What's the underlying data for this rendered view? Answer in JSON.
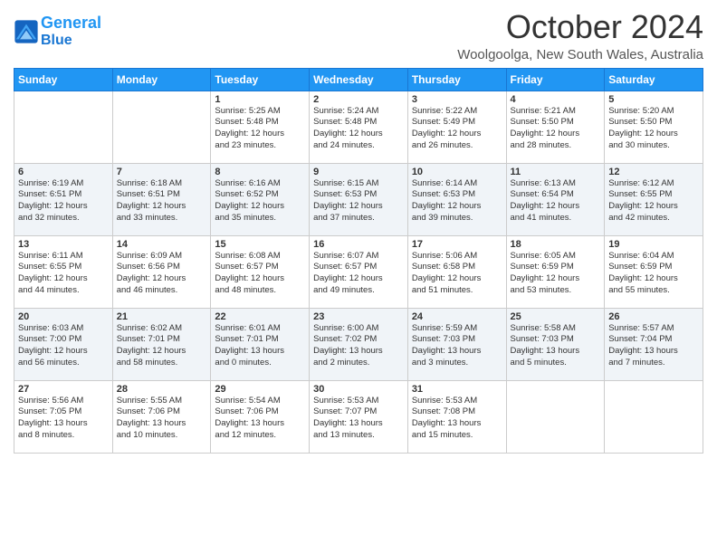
{
  "header": {
    "logo_line1": "General",
    "logo_line2": "Blue",
    "month": "October 2024",
    "location": "Woolgoolga, New South Wales, Australia"
  },
  "days_of_week": [
    "Sunday",
    "Monday",
    "Tuesday",
    "Wednesday",
    "Thursday",
    "Friday",
    "Saturday"
  ],
  "weeks": [
    [
      {
        "day": "",
        "info": ""
      },
      {
        "day": "",
        "info": ""
      },
      {
        "day": "1",
        "info": "Sunrise: 5:25 AM\nSunset: 5:48 PM\nDaylight: 12 hours\nand 23 minutes."
      },
      {
        "day": "2",
        "info": "Sunrise: 5:24 AM\nSunset: 5:48 PM\nDaylight: 12 hours\nand 24 minutes."
      },
      {
        "day": "3",
        "info": "Sunrise: 5:22 AM\nSunset: 5:49 PM\nDaylight: 12 hours\nand 26 minutes."
      },
      {
        "day": "4",
        "info": "Sunrise: 5:21 AM\nSunset: 5:50 PM\nDaylight: 12 hours\nand 28 minutes."
      },
      {
        "day": "5",
        "info": "Sunrise: 5:20 AM\nSunset: 5:50 PM\nDaylight: 12 hours\nand 30 minutes."
      }
    ],
    [
      {
        "day": "6",
        "info": "Sunrise: 6:19 AM\nSunset: 6:51 PM\nDaylight: 12 hours\nand 32 minutes."
      },
      {
        "day": "7",
        "info": "Sunrise: 6:18 AM\nSunset: 6:51 PM\nDaylight: 12 hours\nand 33 minutes."
      },
      {
        "day": "8",
        "info": "Sunrise: 6:16 AM\nSunset: 6:52 PM\nDaylight: 12 hours\nand 35 minutes."
      },
      {
        "day": "9",
        "info": "Sunrise: 6:15 AM\nSunset: 6:53 PM\nDaylight: 12 hours\nand 37 minutes."
      },
      {
        "day": "10",
        "info": "Sunrise: 6:14 AM\nSunset: 6:53 PM\nDaylight: 12 hours\nand 39 minutes."
      },
      {
        "day": "11",
        "info": "Sunrise: 6:13 AM\nSunset: 6:54 PM\nDaylight: 12 hours\nand 41 minutes."
      },
      {
        "day": "12",
        "info": "Sunrise: 6:12 AM\nSunset: 6:55 PM\nDaylight: 12 hours\nand 42 minutes."
      }
    ],
    [
      {
        "day": "13",
        "info": "Sunrise: 6:11 AM\nSunset: 6:55 PM\nDaylight: 12 hours\nand 44 minutes."
      },
      {
        "day": "14",
        "info": "Sunrise: 6:09 AM\nSunset: 6:56 PM\nDaylight: 12 hours\nand 46 minutes."
      },
      {
        "day": "15",
        "info": "Sunrise: 6:08 AM\nSunset: 6:57 PM\nDaylight: 12 hours\nand 48 minutes."
      },
      {
        "day": "16",
        "info": "Sunrise: 6:07 AM\nSunset: 6:57 PM\nDaylight: 12 hours\nand 49 minutes."
      },
      {
        "day": "17",
        "info": "Sunrise: 5:06 AM\nSunset: 6:58 PM\nDaylight: 12 hours\nand 51 minutes."
      },
      {
        "day": "18",
        "info": "Sunrise: 6:05 AM\nSunset: 6:59 PM\nDaylight: 12 hours\nand 53 minutes."
      },
      {
        "day": "19",
        "info": "Sunrise: 6:04 AM\nSunset: 6:59 PM\nDaylight: 12 hours\nand 55 minutes."
      }
    ],
    [
      {
        "day": "20",
        "info": "Sunrise: 6:03 AM\nSunset: 7:00 PM\nDaylight: 12 hours\nand 56 minutes."
      },
      {
        "day": "21",
        "info": "Sunrise: 6:02 AM\nSunset: 7:01 PM\nDaylight: 12 hours\nand 58 minutes."
      },
      {
        "day": "22",
        "info": "Sunrise: 6:01 AM\nSunset: 7:01 PM\nDaylight: 13 hours\nand 0 minutes."
      },
      {
        "day": "23",
        "info": "Sunrise: 6:00 AM\nSunset: 7:02 PM\nDaylight: 13 hours\nand 2 minutes."
      },
      {
        "day": "24",
        "info": "Sunrise: 5:59 AM\nSunset: 7:03 PM\nDaylight: 13 hours\nand 3 minutes."
      },
      {
        "day": "25",
        "info": "Sunrise: 5:58 AM\nSunset: 7:03 PM\nDaylight: 13 hours\nand 5 minutes."
      },
      {
        "day": "26",
        "info": "Sunrise: 5:57 AM\nSunset: 7:04 PM\nDaylight: 13 hours\nand 7 minutes."
      }
    ],
    [
      {
        "day": "27",
        "info": "Sunrise: 5:56 AM\nSunset: 7:05 PM\nDaylight: 13 hours\nand 8 minutes."
      },
      {
        "day": "28",
        "info": "Sunrise: 5:55 AM\nSunset: 7:06 PM\nDaylight: 13 hours\nand 10 minutes."
      },
      {
        "day": "29",
        "info": "Sunrise: 5:54 AM\nSunset: 7:06 PM\nDaylight: 13 hours\nand 12 minutes."
      },
      {
        "day": "30",
        "info": "Sunrise: 5:53 AM\nSunset: 7:07 PM\nDaylight: 13 hours\nand 13 minutes."
      },
      {
        "day": "31",
        "info": "Sunrise: 5:53 AM\nSunset: 7:08 PM\nDaylight: 13 hours\nand 15 minutes."
      },
      {
        "day": "",
        "info": ""
      },
      {
        "day": "",
        "info": ""
      }
    ]
  ]
}
